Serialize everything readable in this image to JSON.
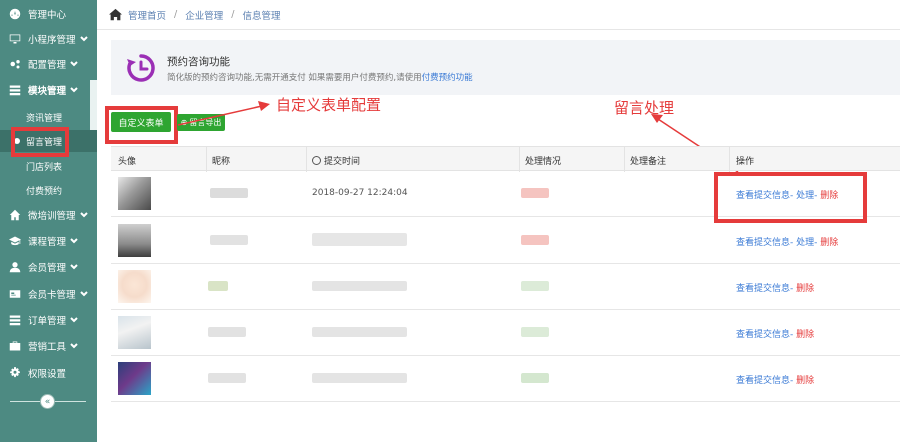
{
  "sidebar": {
    "items": [
      {
        "label": "管理中心",
        "icon": "dashboard-icon",
        "chevron": false
      },
      {
        "label": "小程序管理",
        "icon": "monitor-icon",
        "chevron": true
      },
      {
        "label": "配置管理",
        "icon": "gears-icon",
        "chevron": true
      },
      {
        "label": "模块管理",
        "icon": "grid-icon",
        "chevron": true
      },
      {
        "label": "微培训管理",
        "icon": "home-icon",
        "chevron": true
      },
      {
        "label": "课程管理",
        "icon": "graduation-cap-icon",
        "chevron": true
      },
      {
        "label": "会员管理",
        "icon": "user-icon",
        "chevron": true
      },
      {
        "label": "会员卡管理",
        "icon": "card-icon",
        "chevron": true
      },
      {
        "label": "订单管理",
        "icon": "list-icon",
        "chevron": true
      },
      {
        "label": "营销工具",
        "icon": "briefcase-icon",
        "chevron": true
      },
      {
        "label": "权限设置",
        "icon": "cog-icon",
        "chevron": false
      }
    ],
    "subitems": [
      {
        "label": "资讯管理"
      },
      {
        "label": "留言管理"
      },
      {
        "label": "门店列表"
      },
      {
        "label": "付费预约"
      }
    ],
    "collapse_label": "«"
  },
  "breadcrumb": {
    "home_icon": "home-icon",
    "items": [
      "管理首页",
      "企业管理",
      "信息管理"
    ],
    "separator": "/"
  },
  "info": {
    "title": "预约咨询功能",
    "desc_prefix": "简化版的预约咨询功能,无需开通支付 如果需要用户付费预约,请使用",
    "desc_link": "付费预约功能"
  },
  "toolbar": {
    "custom_form_label": "自定义表单",
    "export_label": "留言导出"
  },
  "annotations": {
    "custom_form_config": "自定义表单配置",
    "message_handling": "留言处理"
  },
  "table": {
    "headers": [
      "头像",
      "昵称",
      "提交时间",
      "处理情况",
      "处理备注",
      "操作"
    ],
    "rows": [
      {
        "time": "2018-09-27 12:24:04",
        "view": "查看提交信息",
        "process": "处理",
        "delete": "删除"
      },
      {
        "time": "",
        "view": "查看提交信息",
        "process": "处理",
        "delete": "删除"
      },
      {
        "time": "",
        "view": "查看提交信息",
        "process": "",
        "delete": "删除"
      },
      {
        "time": "",
        "view": "查看提交信息",
        "process": "",
        "delete": "删除"
      },
      {
        "time": "",
        "view": "查看提交信息",
        "process": "",
        "delete": "删除"
      }
    ],
    "sep": "-"
  },
  "colors": {
    "sidebar_bg": "#4d8a82",
    "accent_green": "#2ea531",
    "annotation_red": "#e53b3b",
    "link_blue": "#3a7ad5"
  }
}
